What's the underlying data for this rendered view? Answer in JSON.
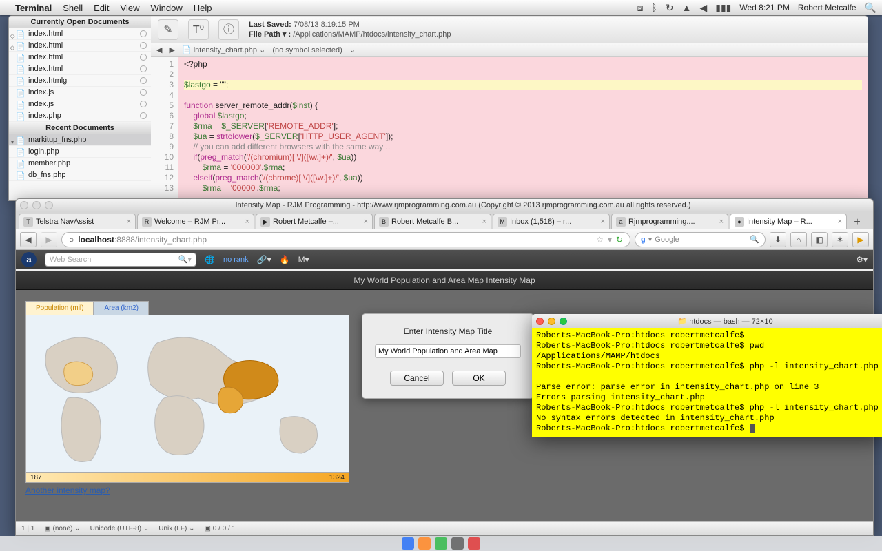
{
  "menubar": {
    "app": "Terminal",
    "items": [
      "Shell",
      "Edit",
      "View",
      "Window",
      "Help"
    ],
    "clock": "Wed 8:21 PM",
    "user": "Robert Metcalfe"
  },
  "editor": {
    "open_header": "Currently Open Documents",
    "recent_header": "Recent Documents",
    "open_files": [
      "index.html",
      "index.html",
      "index.html",
      "index.html",
      "index.htmlg",
      "index.js",
      "index.js",
      "index.php"
    ],
    "recent_files": [
      "markitup_fns.php",
      "login.php",
      "member.php",
      "db_fns.php"
    ],
    "last_saved_label": "Last Saved:",
    "last_saved": "7/08/13 8:19:15 PM",
    "file_path_label": "File Path ▾ :",
    "file_path": "/Applications/MAMP/htdocs/intensity_chart.php",
    "pathbar_file": "intensity_chart.php",
    "pathbar_symbol": "(no symbol selected)",
    "gutter": [
      "1",
      "2",
      "3",
      "4",
      "5",
      "6",
      "7",
      "8",
      "9",
      "10",
      "11",
      "12",
      "13"
    ],
    "code": "<?php\n\n$lastgo = \"\";\n\nfunction server_remote_addr($inst) {\n    global $lastgo;\n    $rma = $_SERVER['REMOTE_ADDR'];\n    $ua = strtolower($_SERVER['HTTP_USER_AGENT']);\n    // you can add different browsers with the same way ..\n    if(preg_match('/(chromium)[ \\/]([\\w.]+)/', $ua))\n        $rma = '000000'.$rma;\n    elseif(preg_match('/(chrome)[ \\/]([\\w.]+)/', $ua))\n        $rma = '00000'.$rma;"
  },
  "browser": {
    "title": "Intensity Map - RJM Programming - http://www.rjmprogramming.com.au (Copyright © 2013 rjmprogramming.com.au all rights reserved.)",
    "tabs": [
      {
        "label": "Telstra NavAssist",
        "fav": "T"
      },
      {
        "label": "Welcome – RJM Pr...",
        "fav": "R"
      },
      {
        "label": "Robert Metcalfe –...",
        "fav": "▶"
      },
      {
        "label": "Robert Metcalfe B...",
        "fav": "B"
      },
      {
        "label": "Inbox (1,518) – r...",
        "fav": "M"
      },
      {
        "label": "Rjmprogramming....",
        "fav": "a"
      },
      {
        "label": "Intensity Map – R...",
        "fav": "●"
      }
    ],
    "active_tab": 6,
    "url_host": "localhost",
    "url_port": ":8888",
    "url_path": "/intensity_chart.php",
    "search_engine": "Google",
    "norank": "no rank",
    "websearch_placeholder": "Web Search",
    "page_title": "My World Population and Area Map Intensity Map",
    "map_tabs": [
      "Population (mil)",
      "Area (km2)"
    ],
    "legend_min": "187",
    "legend_max": "1324",
    "another_link": "Another intensity map?",
    "dialog_label": "Enter Intensity Map Title",
    "dialog_value": "My World Population and Area Map",
    "dialog_cancel": "Cancel",
    "dialog_ok": "OK",
    "status_items": [
      "1 | 1",
      "(none)",
      "Unicode (UTF-8)",
      "Unix (LF)",
      "0 / 0 / 1"
    ]
  },
  "terminal": {
    "title": "htdocs — bash — 72×10",
    "lines": "Roberts-MacBook-Pro:htdocs robertmetcalfe$\nRoberts-MacBook-Pro:htdocs robertmetcalfe$ pwd\n/Applications/MAMP/htdocs\nRoberts-MacBook-Pro:htdocs robertmetcalfe$ php -l intensity_chart.php\n\nParse error: parse error in intensity_chart.php on line 3\nErrors parsing intensity_chart.php\nRoberts-MacBook-Pro:htdocs robertmetcalfe$ php -l intensity_chart.php\nNo syntax errors detected in intensity_chart.php\nRoberts-MacBook-Pro:htdocs robertmetcalfe$ "
  }
}
